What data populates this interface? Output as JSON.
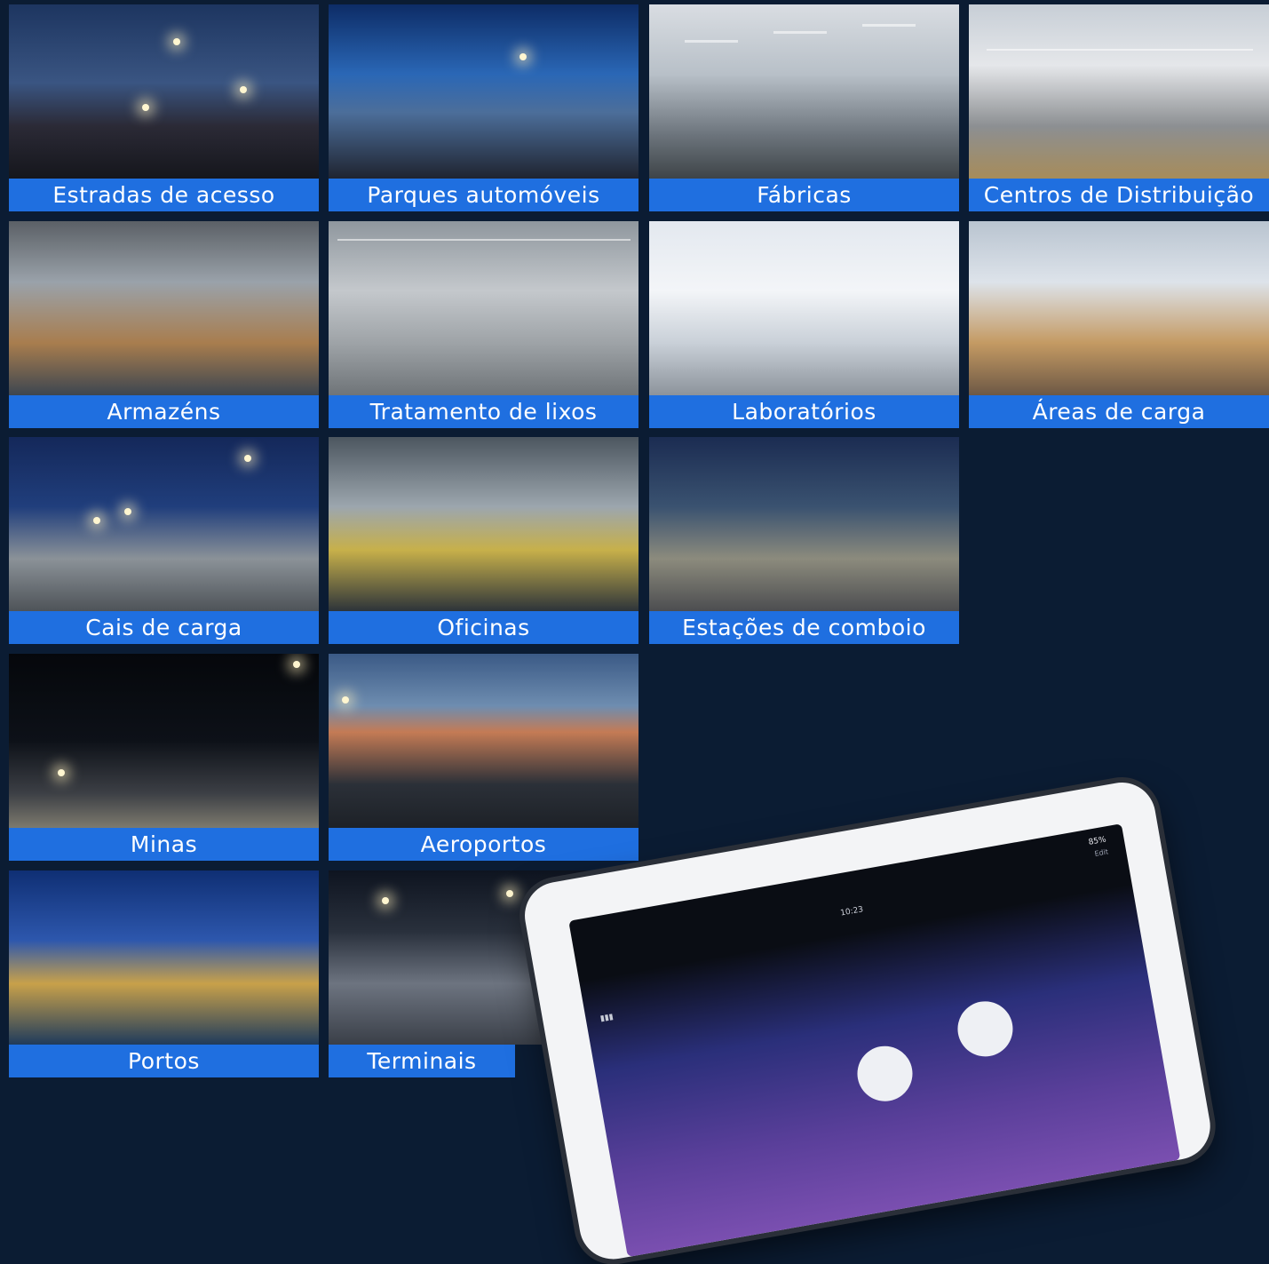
{
  "tiles": [
    {
      "label": "Estradas de acesso"
    },
    {
      "label": "Parques automóveis"
    },
    {
      "label": "Fábricas"
    },
    {
      "label": "Centros de Distribuição"
    },
    {
      "label": "Armazéns"
    },
    {
      "label": "Tratamento de lixos"
    },
    {
      "label": "Laboratórios"
    },
    {
      "label": "Áreas de carga"
    },
    {
      "label": "Cais de carga"
    },
    {
      "label": "Oficinas"
    },
    {
      "label": "Estações de comboio"
    },
    {
      "label": "Minas"
    },
    {
      "label": "Aeroportos"
    },
    {
      "label": "Portos"
    },
    {
      "label": "Terminais"
    }
  ],
  "tablet": {
    "battery": "85%",
    "time": "10:23",
    "edit": "Edit"
  }
}
